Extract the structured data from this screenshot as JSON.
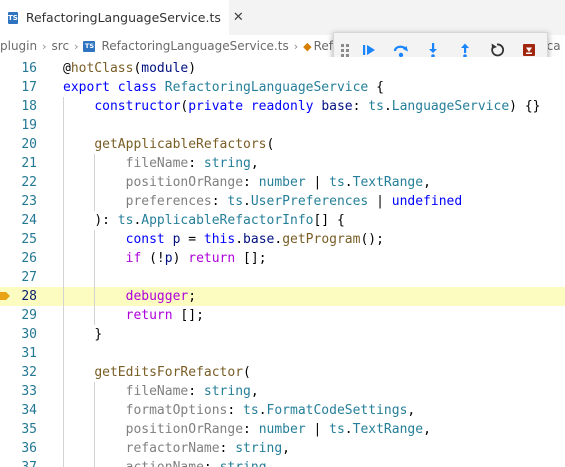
{
  "tab": {
    "label": "RefactoringLanguageService.ts",
    "icon": "typescript-file-icon",
    "close_glyph": "✕"
  },
  "breadcrumb": {
    "items": [
      "plugin",
      "src",
      "RefactoringLanguageService.ts",
      "Refa"
    ],
    "separator": "›",
    "tail": "lica"
  },
  "debug_toolbar": {
    "buttons": [
      {
        "name": "continue",
        "icon": "continue-icon"
      },
      {
        "name": "step-over",
        "icon": "step-over-icon"
      },
      {
        "name": "step-into",
        "icon": "step-into-icon"
      },
      {
        "name": "step-out",
        "icon": "step-out-icon"
      },
      {
        "name": "restart",
        "icon": "restart-icon"
      },
      {
        "name": "stop",
        "icon": "stop-icon"
      }
    ]
  },
  "editor": {
    "current_line": 28,
    "lines": [
      {
        "n": "16",
        "indent": 0,
        "tokens": [
          [
            "tx",
            "@"
          ],
          [
            "fn",
            "hotClass"
          ],
          [
            "tx",
            "("
          ],
          [
            "pr",
            "module"
          ],
          [
            "tx",
            ")"
          ]
        ]
      },
      {
        "n": "17",
        "indent": 0,
        "tokens": [
          [
            "k",
            "export"
          ],
          [
            "tx",
            " "
          ],
          [
            "k",
            "class"
          ],
          [
            "tx",
            " "
          ],
          [
            "cls",
            "RefactoringLanguageService"
          ],
          [
            "tx",
            " {"
          ]
        ]
      },
      {
        "n": "18",
        "indent": 1,
        "tokens": [
          [
            "k",
            "constructor"
          ],
          [
            "tx",
            "("
          ],
          [
            "k",
            "private"
          ],
          [
            "tx",
            " "
          ],
          [
            "k",
            "readonly"
          ],
          [
            "tx",
            " "
          ],
          [
            "pr",
            "base"
          ],
          [
            "tx",
            ": "
          ],
          [
            "cls",
            "ts"
          ],
          [
            "tx",
            "."
          ],
          [
            "cls",
            "LanguageService"
          ],
          [
            "tx",
            ") {}"
          ]
        ]
      },
      {
        "n": "19",
        "indent": 1,
        "tokens": []
      },
      {
        "n": "20",
        "indent": 1,
        "tokens": [
          [
            "fn",
            "getApplicableRefactors"
          ],
          [
            "tx",
            "("
          ]
        ]
      },
      {
        "n": "21",
        "indent": 2,
        "tokens": [
          [
            "pm",
            "fileName"
          ],
          [
            "tx",
            ": "
          ],
          [
            "cls",
            "string"
          ],
          [
            "tx",
            ","
          ]
        ]
      },
      {
        "n": "22",
        "indent": 2,
        "tokens": [
          [
            "pm",
            "positionOrRange"
          ],
          [
            "tx",
            ": "
          ],
          [
            "cls",
            "number"
          ],
          [
            "tx",
            " | "
          ],
          [
            "cls",
            "ts"
          ],
          [
            "tx",
            "."
          ],
          [
            "cls",
            "TextRange"
          ],
          [
            "tx",
            ","
          ]
        ]
      },
      {
        "n": "23",
        "indent": 2,
        "tokens": [
          [
            "pm",
            "preferences"
          ],
          [
            "tx",
            ": "
          ],
          [
            "cls",
            "ts"
          ],
          [
            "tx",
            "."
          ],
          [
            "cls",
            "UserPreferences"
          ],
          [
            "tx",
            " | "
          ],
          [
            "k",
            "undefined"
          ]
        ]
      },
      {
        "n": "24",
        "indent": 1,
        "tokens": [
          [
            "tx",
            "): "
          ],
          [
            "cls",
            "ts"
          ],
          [
            "tx",
            "."
          ],
          [
            "cls",
            "ApplicableRefactorInfo"
          ],
          [
            "tx",
            "[] {"
          ]
        ]
      },
      {
        "n": "25",
        "indent": 2,
        "tokens": [
          [
            "k",
            "const"
          ],
          [
            "tx",
            " "
          ],
          [
            "pr",
            "p"
          ],
          [
            "tx",
            " = "
          ],
          [
            "k",
            "this"
          ],
          [
            "tx",
            "."
          ],
          [
            "pr",
            "base"
          ],
          [
            "tx",
            "."
          ],
          [
            "fn",
            "getProgram"
          ],
          [
            "tx",
            "();"
          ]
        ]
      },
      {
        "n": "26",
        "indent": 2,
        "tokens": [
          [
            "kc",
            "if"
          ],
          [
            "tx",
            " (!"
          ],
          [
            "pr",
            "p"
          ],
          [
            "tx",
            ") "
          ],
          [
            "kc",
            "return"
          ],
          [
            "tx",
            " [];"
          ]
        ]
      },
      {
        "n": "27",
        "indent": 2,
        "tokens": []
      },
      {
        "n": "28",
        "indent": 2,
        "tokens": [
          [
            "kc",
            "debugger"
          ],
          [
            "tx",
            ";"
          ]
        ]
      },
      {
        "n": "29",
        "indent": 2,
        "tokens": [
          [
            "kc",
            "return"
          ],
          [
            "tx",
            " [];"
          ]
        ]
      },
      {
        "n": "30",
        "indent": 1,
        "tokens": [
          [
            "tx",
            "}"
          ]
        ]
      },
      {
        "n": "31",
        "indent": 1,
        "tokens": []
      },
      {
        "n": "32",
        "indent": 1,
        "tokens": [
          [
            "fn",
            "getEditsForRefactor"
          ],
          [
            "tx",
            "("
          ]
        ]
      },
      {
        "n": "33",
        "indent": 2,
        "tokens": [
          [
            "pm",
            "fileName"
          ],
          [
            "tx",
            ": "
          ],
          [
            "cls",
            "string"
          ],
          [
            "tx",
            ","
          ]
        ]
      },
      {
        "n": "34",
        "indent": 2,
        "tokens": [
          [
            "pm",
            "formatOptions"
          ],
          [
            "tx",
            ": "
          ],
          [
            "cls",
            "ts"
          ],
          [
            "tx",
            "."
          ],
          [
            "cls",
            "FormatCodeSettings"
          ],
          [
            "tx",
            ","
          ]
        ]
      },
      {
        "n": "35",
        "indent": 2,
        "tokens": [
          [
            "pm",
            "positionOrRange"
          ],
          [
            "tx",
            ": "
          ],
          [
            "cls",
            "number"
          ],
          [
            "tx",
            " | "
          ],
          [
            "cls",
            "ts"
          ],
          [
            "tx",
            "."
          ],
          [
            "cls",
            "TextRange"
          ],
          [
            "tx",
            ","
          ]
        ]
      },
      {
        "n": "36",
        "indent": 2,
        "tokens": [
          [
            "pm",
            "refactorName"
          ],
          [
            "tx",
            ": "
          ],
          [
            "cls",
            "string"
          ],
          [
            "tx",
            ","
          ]
        ]
      },
      {
        "n": "37",
        "indent": 2,
        "tokens": [
          [
            "pm",
            "actionName"
          ],
          [
            "tx",
            ": "
          ],
          [
            "cls",
            "string"
          ]
        ]
      }
    ]
  },
  "colors": {
    "keyword": "#0000ff",
    "control": "#af00db",
    "type": "#267f99",
    "function": "#795e26",
    "variable": "#001080",
    "current_line_bg": "#fdfcc0",
    "debug_arrow": "#e8a317"
  }
}
